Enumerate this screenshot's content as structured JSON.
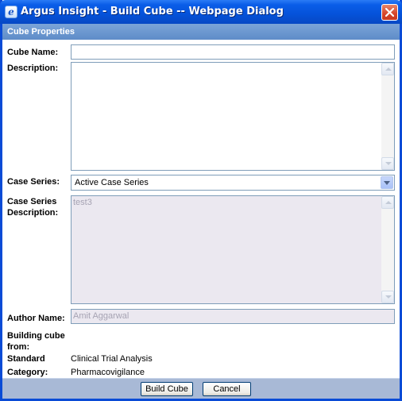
{
  "window": {
    "title": "Argus Insight - Build Cube -- Webpage Dialog",
    "app_icon": "ie-icon",
    "close_icon": "close-icon"
  },
  "section": {
    "header": "Cube Properties"
  },
  "form": {
    "cube_name_label": "Cube Name:",
    "cube_name_value": "",
    "description_label": "Description:",
    "description_value": "",
    "case_series_label": "Case Series:",
    "case_series_value": "Active Case Series",
    "case_series_desc_label_1": "Case Series",
    "case_series_desc_label_2": "Description:",
    "case_series_desc_value": "test3",
    "author_label": "Author Name:",
    "author_value": "Amit Aggarwal",
    "building_label_1": "Building cube",
    "building_label_2": "from:",
    "standard_label": "Standard",
    "standard_value": "Clinical Trial Analysis",
    "category_label": "Category:",
    "category_value": "Pharmacovigilance"
  },
  "buttons": {
    "build": "Build Cube",
    "cancel": "Cancel"
  },
  "colors": {
    "title_bar": "#0552d9",
    "section_header": "#6b97d0",
    "footer": "#a8b9d6",
    "disabled_field": "#ebe8f0"
  }
}
